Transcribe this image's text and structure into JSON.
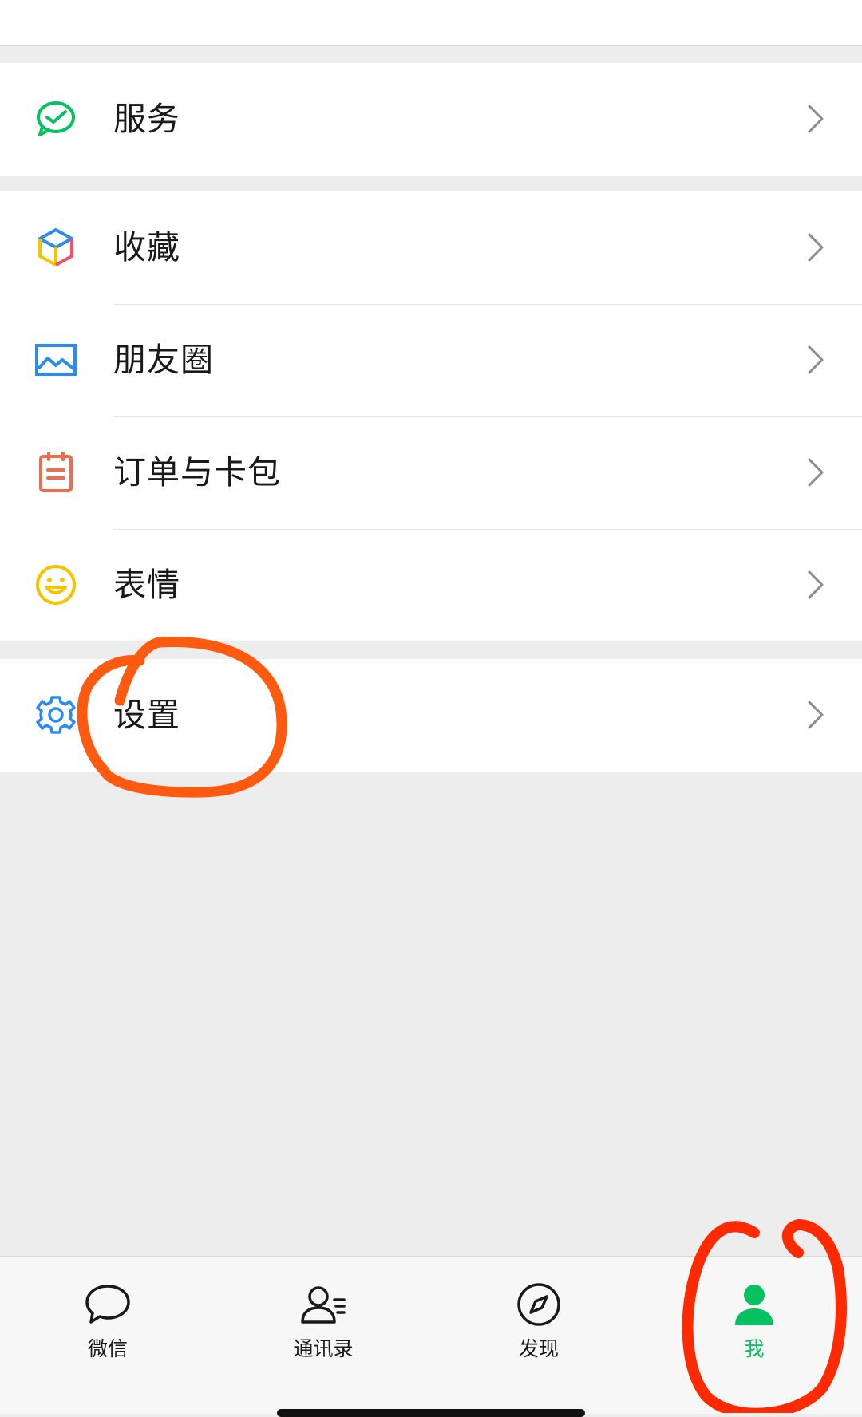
{
  "menu": {
    "group1": [
      {
        "label": "服务",
        "icon": "wechat-pay-icon"
      }
    ],
    "group2": [
      {
        "label": "收藏",
        "icon": "favorites-cube-icon"
      },
      {
        "label": "朋友圈",
        "icon": "moments-image-icon"
      },
      {
        "label": "订单与卡包",
        "icon": "orders-card-icon"
      },
      {
        "label": "表情",
        "icon": "smiley-icon"
      }
    ],
    "group3": [
      {
        "label": "设置",
        "icon": "gear-icon"
      }
    ]
  },
  "bottom_nav": {
    "items": [
      {
        "label": "微信",
        "icon": "chat-bubble-icon",
        "active": false
      },
      {
        "label": "通讯录",
        "icon": "contacts-icon",
        "active": false
      },
      {
        "label": "发现",
        "icon": "compass-icon",
        "active": false
      },
      {
        "label": "我",
        "icon": "person-icon",
        "active": true
      }
    ]
  },
  "colors": {
    "accent_green": "#07c160",
    "background": "#ededed",
    "annotation": "#ff4a0a"
  }
}
